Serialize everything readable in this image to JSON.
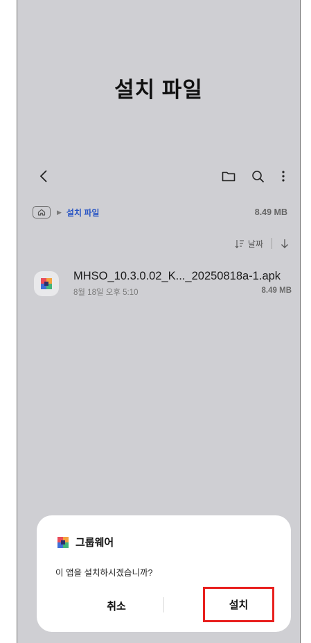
{
  "header": {
    "title": "설치 파일"
  },
  "toolbar": {
    "icons": [
      "back-icon",
      "folder-icon",
      "search-icon",
      "more-icon"
    ]
  },
  "breadcrumb": {
    "current": "설치 파일",
    "size": "8.49 MB"
  },
  "sort": {
    "label": "날짜"
  },
  "file": {
    "name": "MHSO_10.3.0.02_K..._20250818a-1.apk",
    "date": "8월 18일 오후 5:10",
    "size": "8.49 MB"
  },
  "dialog": {
    "app_name": "그룹웨어",
    "message": "이 앱을 설치하시겠습니까?",
    "cancel_label": "취소",
    "install_label": "설치",
    "highlight_color": "#e8201e"
  }
}
